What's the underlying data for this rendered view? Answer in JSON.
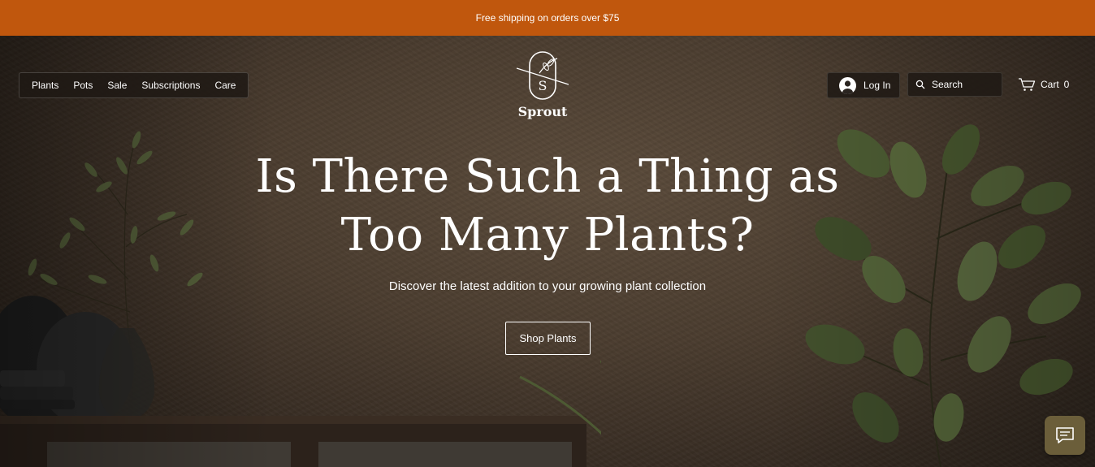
{
  "announcement": {
    "text": "Free shipping on orders over $75"
  },
  "nav": {
    "items": [
      {
        "label": "Plants"
      },
      {
        "label": "Pots"
      },
      {
        "label": "Sale"
      },
      {
        "label": "Subscriptions"
      },
      {
        "label": "Care"
      }
    ]
  },
  "logo": {
    "letter": "S",
    "name": "Sprout"
  },
  "header": {
    "login_label": "Log In",
    "search_label": "Search",
    "cart_label": "Cart",
    "cart_count": "0"
  },
  "hero": {
    "headline_line1": "Is There Such a Thing as",
    "headline_line2": "Too Many Plants?",
    "subheading": "Discover the latest addition to your growing plant collection",
    "cta_label": "Shop Plants"
  },
  "colors": {
    "announcement_bg": "#c0570d",
    "chat_button_bg": "#6b5e3a"
  },
  "icons": [
    "avatar-icon",
    "search-icon",
    "cart-icon",
    "chat-icon",
    "sprout-logo-icon"
  ]
}
